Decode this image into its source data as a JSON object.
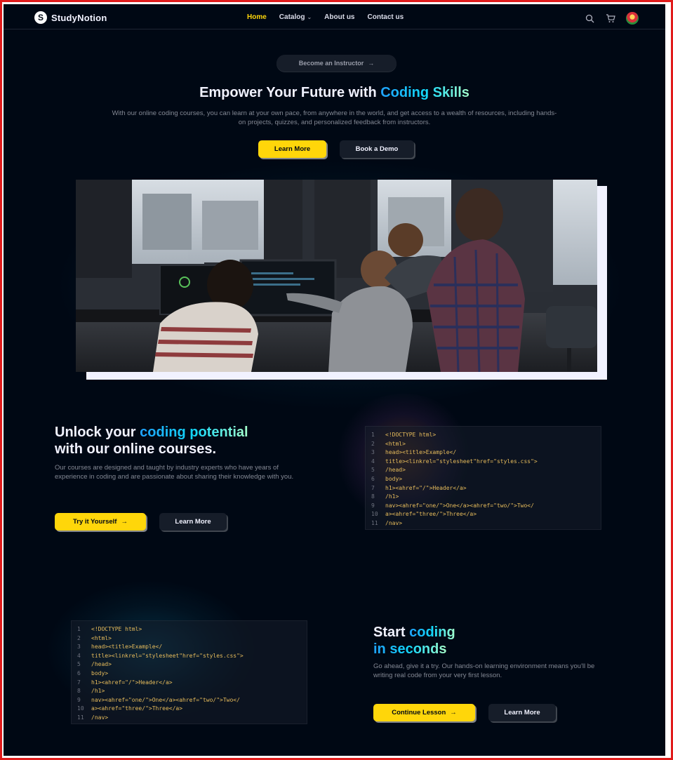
{
  "nav": {
    "logo_mark": "S",
    "logo_text": "StudyNotion",
    "links": [
      {
        "label": "Home",
        "active": true
      },
      {
        "label": "Catalog",
        "dropdown": true
      },
      {
        "label": "About us"
      },
      {
        "label": "Contact us"
      }
    ],
    "icons": [
      "search-icon",
      "cart-icon",
      "avatar"
    ],
    "dropdown_glyph": "⌄"
  },
  "hero": {
    "instructor_button": "Become an Instructor",
    "arrow": "→",
    "title_prefix": "Empower Your Future with ",
    "title_highlight": "Coding Skills",
    "subtitle": "With our online coding courses, you can learn at your own pace, from anywhere in the world, and get access to a wealth of resources, including hands-on projects, quizzes, and personalized feedback from instructors.",
    "primary_button": "Learn More",
    "secondary_button": "Book a Demo"
  },
  "section1": {
    "title_prefix": "Unlock your ",
    "title_highlight": "coding potential",
    "title_suffix": "with our online courses.",
    "description": "Our courses are designed and taught by industry experts who have years of experience in coding and are passionate about sharing their knowledge with you.",
    "primary_button": "Try it Yourself",
    "secondary_button": "Learn More",
    "code_color": "#e7bc5b",
    "code_lines": [
      "<!DOCTYPE html>",
      "<html>",
      "head><title>Example</",
      "title><linkrel=\"stylesheet\"href=\"styles.css\">",
      "/head>",
      "body>",
      "h1><ahref=\"/\">Header</a>",
      "/h1>",
      "nav><ahref=\"one/\">One</a><ahref=\"two/\">Two</",
      "a><ahref=\"three/\">Three</a>",
      "/nav>"
    ]
  },
  "section2": {
    "title_prefix": "Start ",
    "title_highlight_1": "coding",
    "title_highlight_2": "in seconds",
    "description": "Go ahead, give it a try. Our hands-on learning environment means you'll be writing real code from your very first lesson.",
    "primary_button": "Continue Lesson",
    "secondary_button": "Learn More",
    "code_color": "#e7bc5b",
    "code_lines": [
      "<!DOCTYPE html>",
      "<html>",
      "head><title>Example</",
      "title><linkrel=\"stylesheet\"href=\"styles.css\">",
      "/head>",
      "body>",
      "h1><ahref=\"/\">Header</a>",
      "/h1>",
      "nav><ahref=\"one/\">One</a><ahref=\"two/\">Two</",
      "a><ahref=\"three/\">Three</a>",
      "/nav>"
    ]
  },
  "colors": {
    "background": "#000814",
    "accent_yellow": "#ffd60a",
    "accent_blue": "#12d8fa",
    "frame_border": "#e01b1b"
  }
}
